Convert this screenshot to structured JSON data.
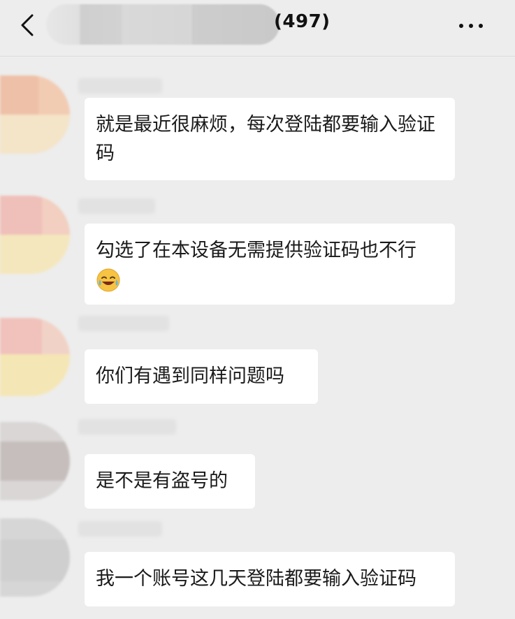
{
  "header": {
    "title_count": "(497)",
    "back_icon": "chevron-left-icon",
    "more_icon": "ellipsis-icon"
  },
  "messages": [
    {
      "text": "就是最近很麻烦，每次登陆都要输入验证码"
    },
    {
      "text": "勾选了在本设备无需提供验证码也不行",
      "emoji": "face-with-tears-of-joy-icon"
    },
    {
      "text": "你们有遇到同样问题吗"
    },
    {
      "text": "是不是有盗号的"
    },
    {
      "text": "我一个账号这几天登陆都要输入验证码"
    }
  ],
  "colors": {
    "background": "#ededed",
    "bubble": "#ffffff",
    "text": "#1a1a1a"
  }
}
